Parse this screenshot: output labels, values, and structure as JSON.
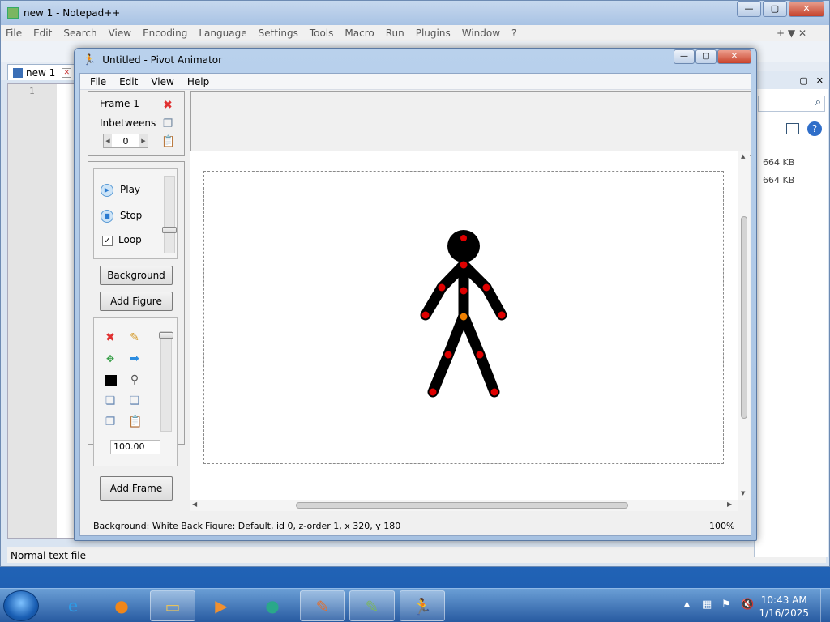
{
  "notepad": {
    "title": "new 1 - Notepad++",
    "menu": [
      "File",
      "Edit",
      "Search",
      "View",
      "Encoding",
      "Language",
      "Settings",
      "Tools",
      "Macro",
      "Run",
      "Plugins",
      "Window",
      "?"
    ],
    "menu_right": "+ ▼ ✕",
    "tab": "new 1",
    "line_number": "1",
    "status": "Normal text file"
  },
  "explorer": {
    "sizes": [
      "664 KB",
      "664 KB"
    ]
  },
  "pivot": {
    "title": "Untitled - Pivot Animator",
    "menu": [
      "File",
      "Edit",
      "View",
      "Help"
    ],
    "frame_label": "Frame 1",
    "inbetweens_label": "Inbetweens",
    "inbetweens_value": "0",
    "play_label": "Play",
    "stop_label": "Stop",
    "loop_label": "Loop",
    "loop_checked": true,
    "background_button": "Background",
    "add_figure_button": "Add Figure",
    "scale_value": "100.00",
    "add_frame_button": "Add Frame",
    "status": {
      "background": "Background: White Back",
      "figure": "Figure: Default,  id 0,  z-order 1,  x 320, y 180",
      "zoom": "100%"
    },
    "figure_color": "#000000",
    "joint_color": "#e00000",
    "origin_joint_color": "#f08000"
  },
  "taskbar": {
    "time": "10:43 AM",
    "date": "1/16/2025"
  }
}
